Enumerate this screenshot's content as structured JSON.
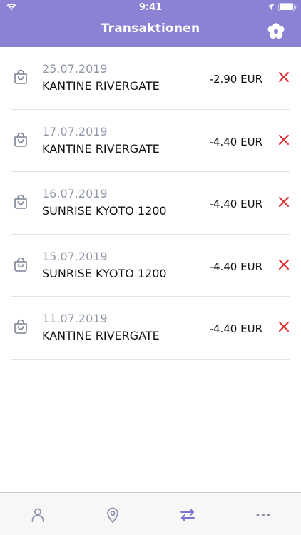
{
  "status_bar": {
    "time": "9:41"
  },
  "header": {
    "title": "Transaktionen",
    "settings_icon": "flower-settings-icon"
  },
  "colors": {
    "header": "#8a82d4",
    "accent": "#7b73cf",
    "delete": "#e52a2a",
    "date": "#9097a6",
    "tab_inactive": "#8a8fa8"
  },
  "transactions": [
    {
      "date": "25.07.2019",
      "merchant": "KANTINE RIVERGATE",
      "amount": "-2.90 EUR"
    },
    {
      "date": "17.07.2019",
      "merchant": "KANTINE RIVERGATE",
      "amount": "-4.40 EUR"
    },
    {
      "date": "16.07.2019",
      "merchant": "SUNRISE KYOTO 1200",
      "amount": "-4.40 EUR"
    },
    {
      "date": "15.07.2019",
      "merchant": "SUNRISE KYOTO 1200",
      "amount": "-4.40 EUR"
    },
    {
      "date": "11.07.2019",
      "merchant": "KANTINE RIVERGATE",
      "amount": "-4.40 EUR"
    }
  ],
  "tabbar": {
    "tabs": [
      {
        "icon": "person-icon",
        "active": false
      },
      {
        "icon": "location-pin-icon",
        "active": false
      },
      {
        "icon": "transfer-arrows-icon",
        "active": true
      },
      {
        "icon": "more-dots-icon",
        "active": false
      }
    ]
  }
}
